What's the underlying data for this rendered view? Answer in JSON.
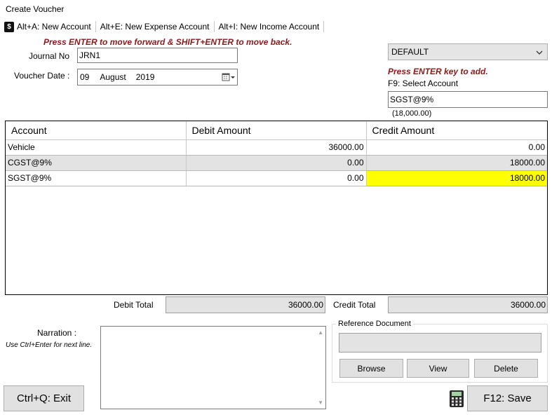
{
  "window": {
    "title": "Create Voucher"
  },
  "toolbar": {
    "items": [
      {
        "label": "Alt+A: New Account"
      },
      {
        "label": "Alt+E: New Expense Account"
      },
      {
        "label": "Alt+I: New Income Account"
      }
    ]
  },
  "hints": {
    "navigation": "Press ENTER to move forward & SHIFT+ENTER to move back.",
    "add": "Press ENTER key to add."
  },
  "form": {
    "journal_no_label": "Journal No",
    "journal_no_value": "JRN1",
    "voucher_date_label": "Voucher Date :",
    "date_day": "09",
    "date_month": "August",
    "date_year": "2019"
  },
  "account_type": {
    "selected": "DEFAULT"
  },
  "account_select": {
    "label": "F9: Select Account",
    "value": "SGST@9%",
    "balance": "(18,000.00)"
  },
  "grid": {
    "headers": [
      "Account",
      "Debit Amount",
      "Credit Amount"
    ],
    "rows": [
      {
        "account": "Vehicle",
        "debit": "36000.00",
        "credit": "0.00"
      },
      {
        "account": "CGST@9%",
        "debit": "0.00",
        "credit": "18000.00"
      },
      {
        "account": "SGST@9%",
        "debit": "0.00",
        "credit": "18000.00"
      }
    ]
  },
  "totals": {
    "debit_label": "Debit Total",
    "debit_value": "36000.00",
    "credit_label": "Credit Total",
    "credit_value": "36000.00"
  },
  "narration": {
    "label": "Narration :",
    "hint": "Use Ctrl+Enter for next line."
  },
  "reference": {
    "title": "Reference Document",
    "browse": "Browse",
    "view": "View",
    "delete": "Delete"
  },
  "actions": {
    "exit": "Ctrl+Q: Exit",
    "save": "F12: Save"
  },
  "colors": {
    "hint_text": "#8b1a1a",
    "highlight_cell": "#ffff00",
    "alt_row": "#e3e3e3"
  }
}
